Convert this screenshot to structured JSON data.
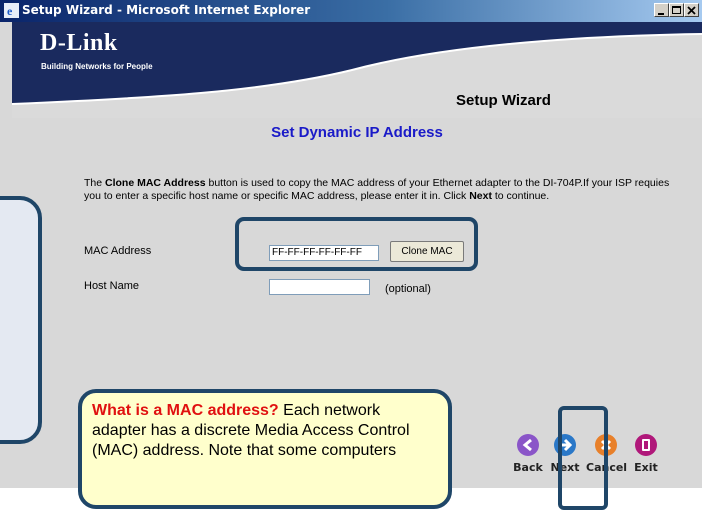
{
  "window": {
    "title": "Setup Wizard - Microsoft Internet Explorer"
  },
  "header": {
    "logo": "D-Link",
    "tagline": "Building Networks for People",
    "wizard_title": "Setup Wizard"
  },
  "page": {
    "section_title": "Set Dynamic IP Address",
    "description": {
      "p1": "The ",
      "b1": "Clone MAC Address",
      "p2": " button is used to copy the MAC address of your Ethernet adapter to the DI-704P.If your ISP requies you to enter a specific host name or specific MAC address, please enter it in. Click ",
      "b2": "Next",
      "p3": " to continue."
    },
    "mac_label": "MAC Address",
    "mac_value": "FF-FF-FF-FF-FF-FF",
    "clone_button": "Clone MAC",
    "host_label": "Host Name",
    "host_value": "",
    "host_hint": "(optional)"
  },
  "tip": {
    "question": "What is a MAC address?",
    "text": " Each network adapter has a discrete Media Access Control (MAC) address. Note that some computers"
  },
  "nav": {
    "back": "Back",
    "next": "Next",
    "cancel": "Cancel",
    "exit": "Exit"
  },
  "colors": {
    "section_title": "#1a1ac8",
    "highlight_border": "#1f4668",
    "tip_background": "#ffffcc",
    "tip_question": "#e01010",
    "back_icon": "#8a55c8",
    "next_icon": "#2a78c8",
    "cancel_icon": "#e8802a",
    "exit_icon": "#b0187a"
  }
}
